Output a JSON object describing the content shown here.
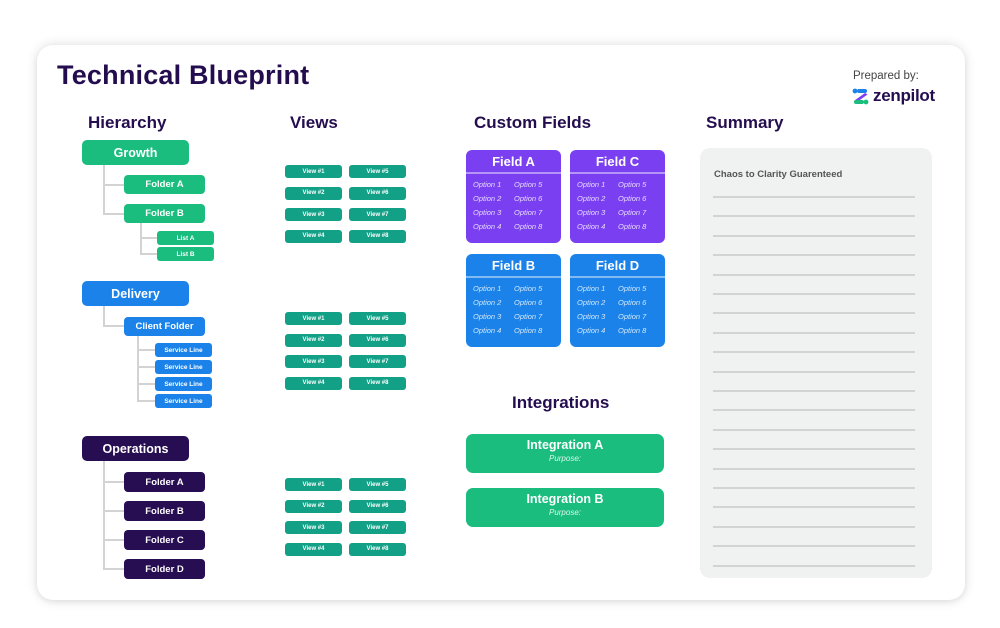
{
  "title": "Technical Blueprint",
  "prepared_by": "Prepared by:",
  "brand": {
    "name": "zenpilot",
    "icon": "zenpilot-logo-icon"
  },
  "colors": {
    "primary_text": "#240d4f",
    "green": "#1bbd7f",
    "blue": "#1a82e8",
    "dark_purple": "#270d52",
    "teal": "#12a086",
    "purple": "#7b3ff2",
    "summary_bg": "#f0f1f1"
  },
  "sections": {
    "hierarchy": "Hierarchy",
    "views": "Views",
    "custom_fields": "Custom Fields",
    "summary": "Summary",
    "integrations": "Integrations"
  },
  "hierarchy": {
    "growth": {
      "label": "Growth",
      "folders": [
        "Folder A",
        "Folder B"
      ],
      "lists": [
        "List A",
        "List B"
      ]
    },
    "delivery": {
      "label": "Delivery",
      "folder": "Client Folder",
      "lists": [
        "Service Line",
        "Service Line",
        "Service Line",
        "Service Line"
      ]
    },
    "operations": {
      "label": "Operations",
      "folders": [
        "Folder A",
        "Folder B",
        "Folder C",
        "Folder D"
      ]
    }
  },
  "views": [
    {
      "group": "growth",
      "items": [
        "View #1",
        "View #2",
        "View #3",
        "View #4",
        "View #5",
        "View #6",
        "View #7",
        "View #8"
      ]
    },
    {
      "group": "delivery",
      "items": [
        "View #1",
        "View #2",
        "View #3",
        "View #4",
        "View #5",
        "View #6",
        "View #7",
        "View #8"
      ]
    },
    {
      "group": "operations",
      "items": [
        "View #1",
        "View #2",
        "View #3",
        "View #4",
        "View #5",
        "View #6",
        "View #7",
        "View #8"
      ]
    }
  ],
  "custom_fields": [
    {
      "name": "Field A",
      "options": [
        "Option 1",
        "Option 5",
        "Option 2",
        "Option 6",
        "Option 3",
        "Option 7",
        "Option 4",
        "Option 8"
      ]
    },
    {
      "name": "Field C",
      "options": [
        "Option 1",
        "Option 5",
        "Option 2",
        "Option 6",
        "Option 3",
        "Option 7",
        "Option 4",
        "Option 8"
      ]
    },
    {
      "name": "Field B",
      "options": [
        "Option 1",
        "Option 5",
        "Option 2",
        "Option 6",
        "Option 3",
        "Option 7",
        "Option 4",
        "Option 8"
      ]
    },
    {
      "name": "Field D",
      "options": [
        "Option 1",
        "Option 5",
        "Option 2",
        "Option 6",
        "Option 3",
        "Option 7",
        "Option 4",
        "Option 8"
      ]
    }
  ],
  "integrations": [
    {
      "name": "Integration A",
      "purpose": "Purpose:"
    },
    {
      "name": "Integration B",
      "purpose": "Purpose:"
    }
  ],
  "summary": {
    "title": "Chaos to Clarity Guarenteed",
    "line_count": 20
  }
}
